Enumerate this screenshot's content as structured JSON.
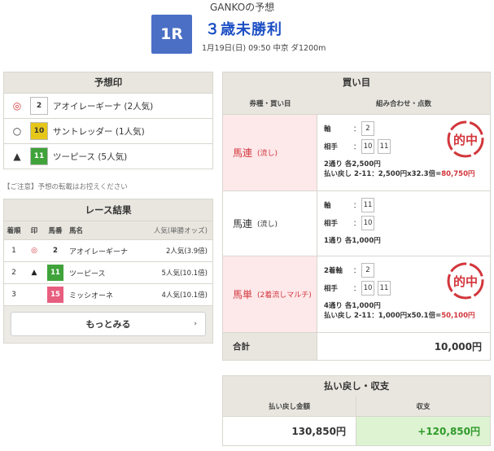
{
  "header": {
    "predictor": "GANKOの予想",
    "race_no": "1R",
    "race_name": "３歳未勝利",
    "race_info": "1月19日(日) 09:50 中京 ダ1200m"
  },
  "marks": {
    "title": "予想印",
    "rows": [
      {
        "symbol": "◎",
        "num": "2",
        "num_bg": "#ffffff",
        "num_fg": "#333333",
        "name": "アオイレーギーナ",
        "pop": "(2人気)"
      },
      {
        "symbol": "○",
        "num": "10",
        "num_bg": "#e6c619",
        "num_fg": "#333333",
        "name": "サントレッダー",
        "pop": "(1人気)"
      },
      {
        "symbol": "▲",
        "num": "11",
        "num_bg": "#3fa33a",
        "num_fg": "#ffffff",
        "name": "ツーピース",
        "pop": "(5人気)"
      }
    ],
    "caution": "【ご注意】予想の転載はお控えください"
  },
  "results": {
    "title": "レース結果",
    "columns": [
      "着順",
      "印",
      "馬番",
      "馬名",
      "人気(単勝オッズ)"
    ],
    "rows": [
      {
        "rank": "1",
        "mark": "◎",
        "mark_color": "#d2363c",
        "num": "2",
        "num_bg": "#ffffff",
        "num_fg": "#333333",
        "name": "アオイレーギーナ",
        "pop": "2人気(3.9倍)"
      },
      {
        "rank": "2",
        "mark": "▲",
        "mark_color": "#222222",
        "num": "11",
        "num_bg": "#3fa33a",
        "num_fg": "#ffffff",
        "name": "ツーピース",
        "pop": "5人気(10.1倍)"
      },
      {
        "rank": "3",
        "mark": "",
        "mark_color": "#222222",
        "num": "15",
        "num_bg": "#e85e7f",
        "num_fg": "#ffffff",
        "name": "ミッシオーネ",
        "pop": "4人気(10.1倍)"
      }
    ],
    "more_label": "もっとみる",
    "more_arrow": "›"
  },
  "bets": {
    "title": "買い目",
    "columns": [
      "券種・買い目",
      "組み合わせ・点数"
    ],
    "rows": [
      {
        "type": "馬連",
        "sub": "(流し)",
        "hit": true,
        "lines": [
          {
            "label": "軸",
            "nums": [
              "2"
            ]
          },
          {
            "label": "相手",
            "nums": [
              "10",
              "11"
            ]
          }
        ],
        "summary": "2通り 各2,500円",
        "payout_prefix": "払い戻し 2-11：2,500円x32.3倍=",
        "payout_value": "80,750円"
      },
      {
        "type": "馬連",
        "sub": "(流し)",
        "hit": false,
        "lines": [
          {
            "label": "軸",
            "nums": [
              "11"
            ]
          },
          {
            "label": "相手",
            "nums": [
              "10"
            ]
          }
        ],
        "summary": "1通り 各1,000円",
        "payout_prefix": "",
        "payout_value": ""
      },
      {
        "type": "馬単",
        "sub": "(2着流しマルチ)",
        "hit": true,
        "lines": [
          {
            "label": "2着軸",
            "nums": [
              "2"
            ]
          },
          {
            "label": "相手",
            "nums": [
              "10",
              "11"
            ]
          }
        ],
        "summary": "4通り 各1,000円",
        "payout_prefix": "払い戻し 2-11：1,000円x50.1倍=",
        "payout_value": "50,100円"
      }
    ],
    "stamp_text": "的中",
    "total_label": "合計",
    "total_value": "10,000円"
  },
  "payout": {
    "title": "払い戻し・収支",
    "col1": "払い戻し金額",
    "col2": "収支",
    "amount": "130,850円",
    "balance": "+120,850円"
  },
  "colors": {
    "accent": "#4a6fc5",
    "hit_red": "#d2363c",
    "positive_green": "#2f9a2a"
  }
}
